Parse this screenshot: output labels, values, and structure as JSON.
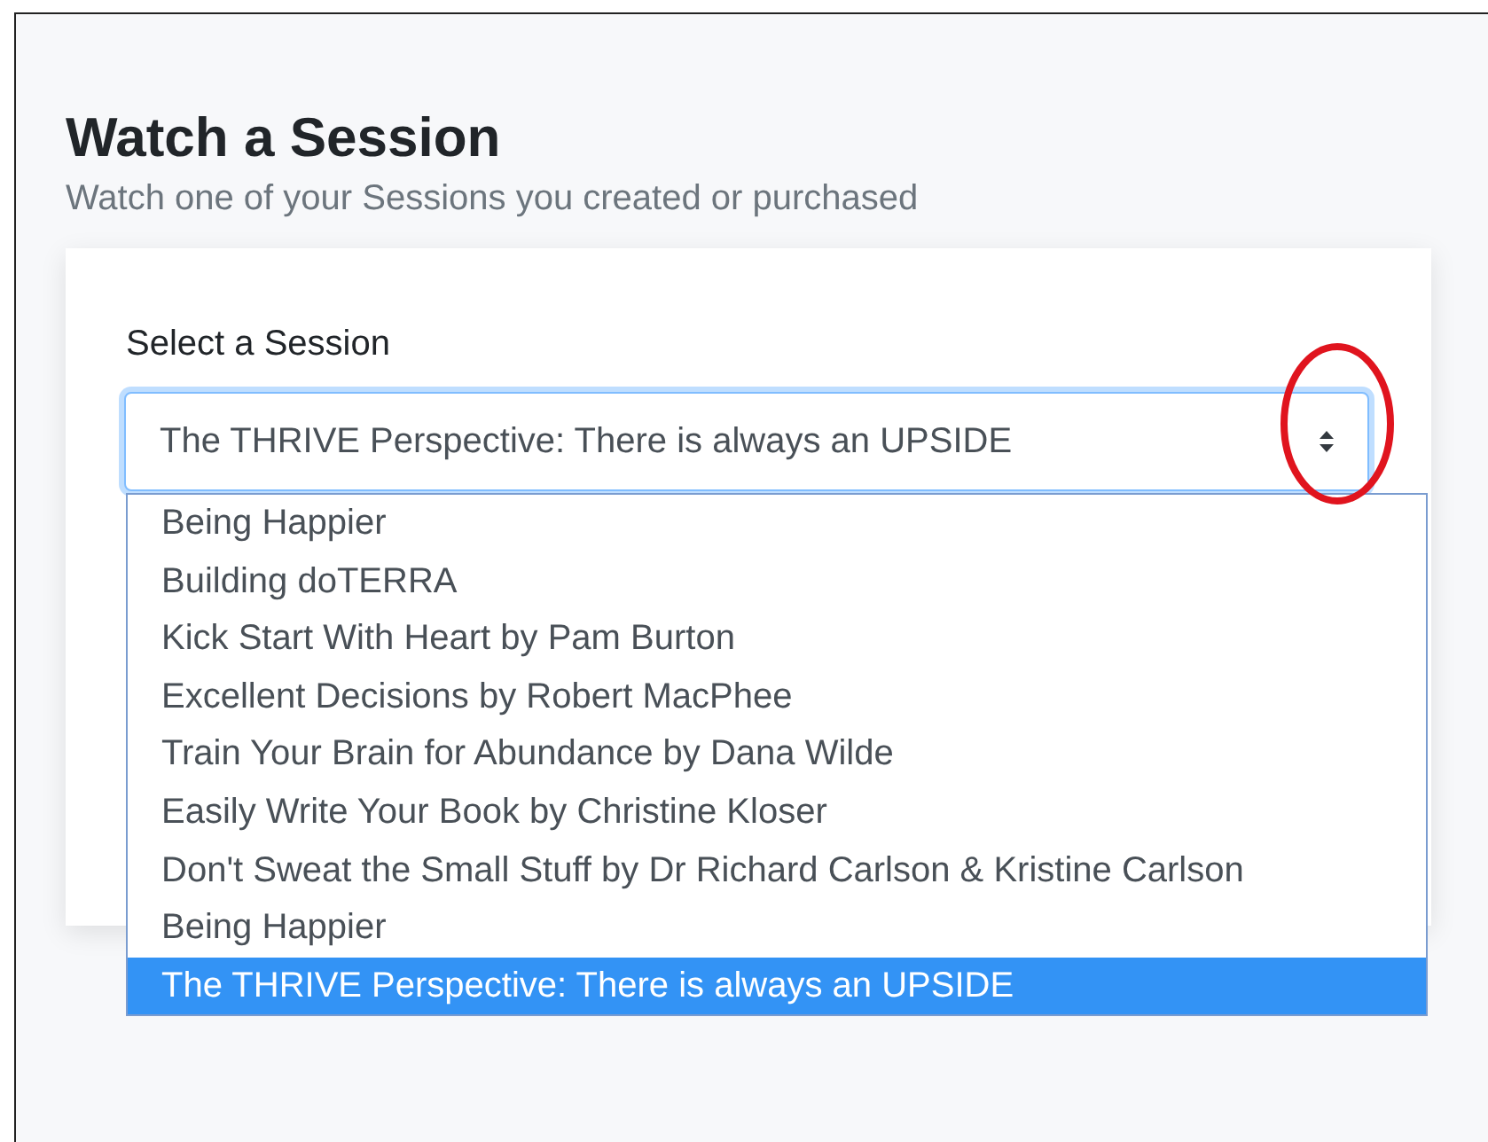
{
  "page": {
    "title": "Watch a Session",
    "subtitle": "Watch one of your Sessions you created or purchased"
  },
  "form": {
    "label": "Select a Session",
    "select": {
      "value": "The THRIVE Perspective: There is always an UPSIDE",
      "expanded": true
    },
    "options": [
      {
        "label": "Being Happier",
        "selected": false
      },
      {
        "label": "Building doTERRA",
        "selected": false
      },
      {
        "label": "Kick Start With Heart by Pam Burton",
        "selected": false
      },
      {
        "label": "Excellent Decisions by Robert MacPhee",
        "selected": false
      },
      {
        "label": "Train Your Brain for Abundance by Dana Wilde",
        "selected": false
      },
      {
        "label": "Easily Write Your Book by Christine Kloser",
        "selected": false
      },
      {
        "label": "Don't Sweat the Small Stuff by Dr Richard Carlson & Kristine Carlson",
        "selected": false
      },
      {
        "label": "Being Happier",
        "selected": false
      },
      {
        "label": "The THRIVE Perspective: There is always an UPSIDE",
        "selected": true
      }
    ]
  }
}
